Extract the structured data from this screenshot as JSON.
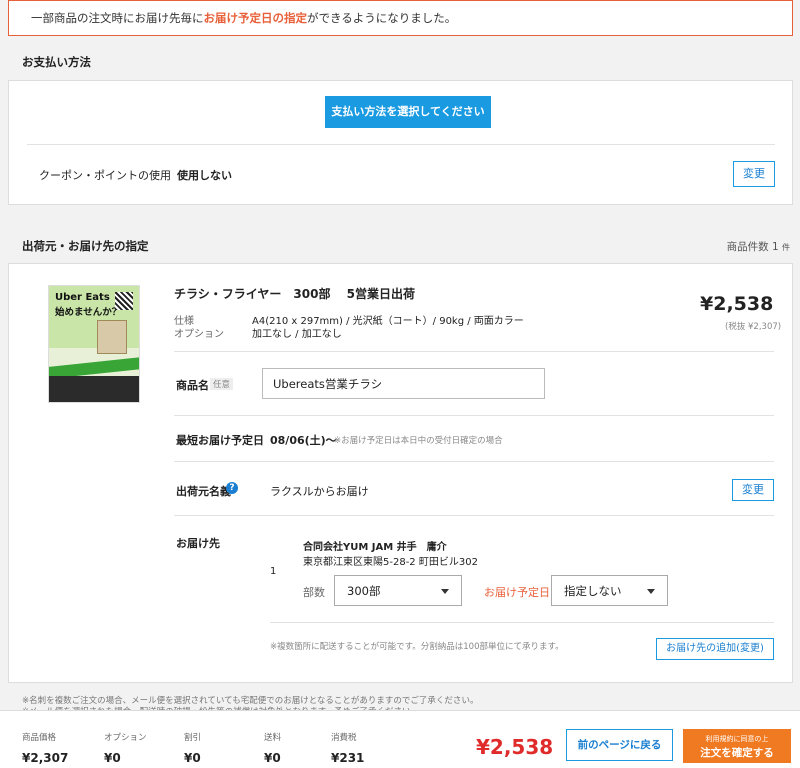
{
  "notice": {
    "pre": "一部商品の注文時にお届け先毎に",
    "highlight": "お届け予定日の指定",
    "post": "ができるようになりました。"
  },
  "payment": {
    "section_title": "お支払い方法",
    "select_button": "支払い方法を選択してください",
    "coupon_label": "クーポン・ポイントの使用",
    "coupon_value": "使用しない",
    "change_label": "変更"
  },
  "shipping": {
    "section_title": "出荷元・お届け先の指定",
    "count_label": "商品件数",
    "count_value": "1",
    "count_unit": "件"
  },
  "product": {
    "title": "チラシ・フライヤー　300部　 5営業日出荷",
    "spec_label": "仕様",
    "spec_value": "A4(210 x 297mm) / 光沢紙（コート）/ 90kg / 両面カラー",
    "option_label": "オプション",
    "option_value": "加工なし / 加工なし",
    "price": "¥2,538",
    "price_excl": "(税抜 ¥2,307)",
    "thumb_text1": "Uber Eats",
    "thumb_text2": "始めませんか？",
    "name_label": "商品名",
    "name_optional": "任意",
    "name_value": "Ubereats営業チラシ",
    "earliest_label": "最短お届け予定日",
    "earliest_value": "08/06(土)〜",
    "earliest_note": "※お届け予定日は本日中の受付日確定の場合",
    "shipper_label": "出荷元名義",
    "shipper_value": "ラクスルからお届け",
    "shipper_change": "変更",
    "dest_label": "お届け先",
    "dest_index": "1",
    "dest_name": "合同会社YUM JAM 井手　庸介",
    "dest_address": "東京都江東区東陽5-28-2 町田ビル302",
    "qty_label": "部数",
    "qty_value": "300部",
    "date_label": "お届け予定日",
    "date_value": "指定しない",
    "multi_note": "※複数箇所に配送することが可能です。分割納品は100部単位にて承ります。",
    "add_dest_button": "お届け先の追加(変更)"
  },
  "footnotes": {
    "line1": "※名刺を複数ご注文の場合、メール便を選択されていても宅配便でのお届けとなることがありますのでご了承ください。",
    "line2": "※メール便を選択された場合、配送時の破損・紛失等の補償は対象外となります。予めご了承ください。"
  },
  "footer": {
    "items": [
      {
        "label": "商品価格",
        "value": "¥2,307"
      },
      {
        "label": "オプション",
        "value": "¥0"
      },
      {
        "label": "割引",
        "value": "¥0"
      },
      {
        "label": "送料",
        "value": "¥0"
      },
      {
        "label": "消費税",
        "value": "¥231"
      }
    ],
    "total": "¥2,538",
    "back_button": "前のページに戻る",
    "confirm_small": "利用規約に同意の上",
    "confirm_main": "注文を確定する"
  },
  "colors": {
    "accent": "#1a9ae0",
    "warning": "#e8603a",
    "price": "#e02b2b",
    "confirm": "#f07a22"
  }
}
